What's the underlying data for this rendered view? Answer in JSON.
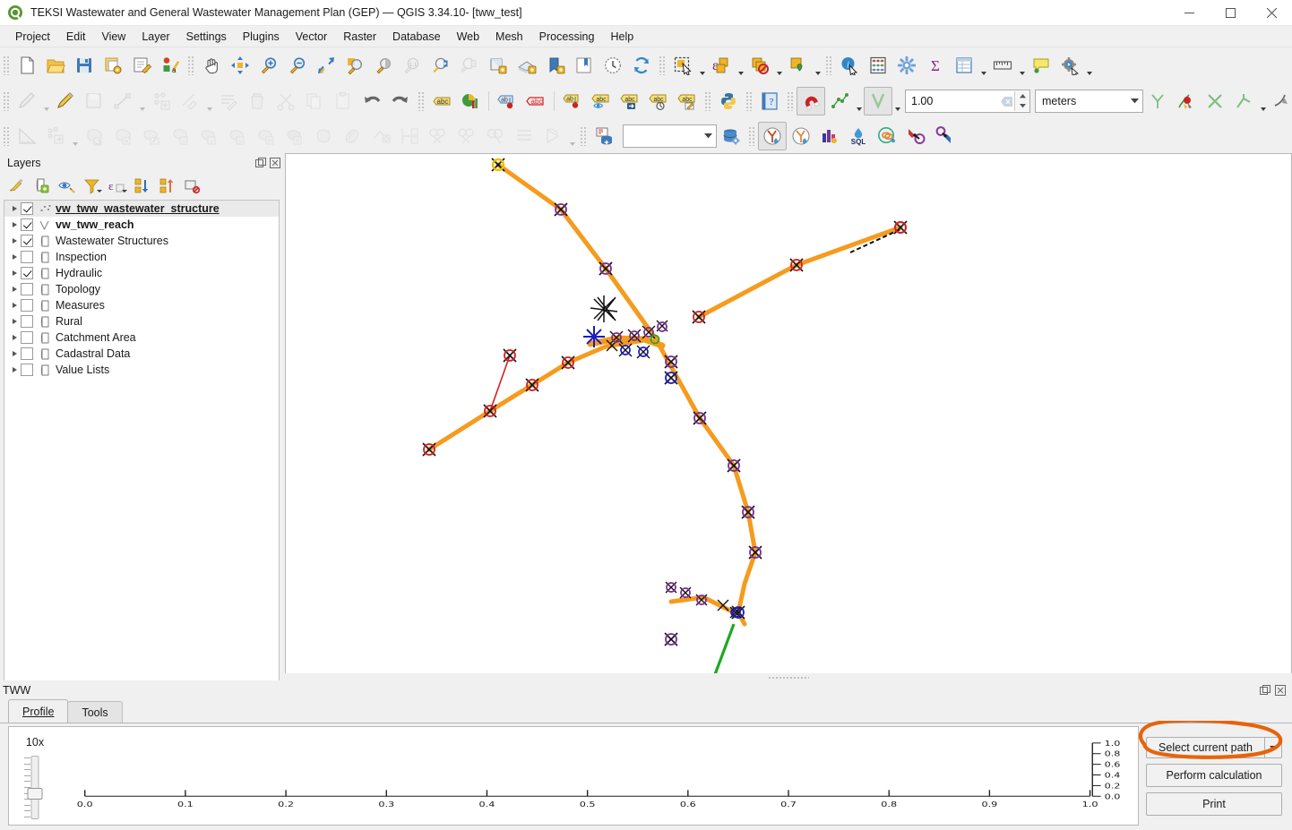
{
  "window": {
    "title": "TEKSI Wastewater and General Wastewater Management Plan (GEP) — QGIS 3.34.10- [tww_test]",
    "app_icon": "qgis-logo-icon",
    "minimize": "—",
    "maximize": "▢",
    "close": "✕"
  },
  "menubar": {
    "items": [
      {
        "label": "Project"
      },
      {
        "label": "Edit"
      },
      {
        "label": "View"
      },
      {
        "label": "Layer"
      },
      {
        "label": "Settings"
      },
      {
        "label": "Plugins"
      },
      {
        "label": "Vector"
      },
      {
        "label": "Raster"
      },
      {
        "label": "Database"
      },
      {
        "label": "Web"
      },
      {
        "label": "Mesh"
      },
      {
        "label": "Processing"
      },
      {
        "label": "Help"
      }
    ]
  },
  "toolbar_row1": [
    {
      "name": "new-project-icon"
    },
    {
      "name": "open-project-icon"
    },
    {
      "name": "save-project-icon"
    },
    {
      "name": "save-project-as-icon"
    },
    {
      "name": "new-print-layout-icon"
    },
    {
      "name": "style-manager-icon"
    },
    {
      "name": "pan-map-icon"
    },
    {
      "name": "pan-to-selection-icon"
    },
    {
      "name": "zoom-in-icon"
    },
    {
      "name": "zoom-out-icon"
    },
    {
      "name": "zoom-full-icon"
    },
    {
      "name": "zoom-to-selection-icon"
    },
    {
      "name": "zoom-to-layer-icon"
    },
    {
      "name": "zoom-native-icon"
    },
    {
      "name": "zoom-last-icon"
    },
    {
      "name": "zoom-next-icon"
    },
    {
      "name": "new-map-view-icon"
    },
    {
      "name": "new-3d-map-view-icon"
    },
    {
      "name": "show-bookmarks-icon"
    },
    {
      "name": "new-bookmark-icon"
    },
    {
      "name": "temporal-controller-icon"
    },
    {
      "name": "refresh-icon"
    },
    {
      "name": "select-features-icon"
    },
    {
      "name": "select-by-expression-icon"
    },
    {
      "name": "deselect-features-icon"
    },
    {
      "name": "identify-highlight-icon"
    },
    {
      "name": "identify-features-icon"
    },
    {
      "name": "field-calculator-icon"
    },
    {
      "name": "options-icon"
    },
    {
      "name": "statistical-summary-icon"
    },
    {
      "name": "open-attribute-table-icon"
    },
    {
      "name": "measure-line-icon"
    },
    {
      "name": "map-tips-icon"
    },
    {
      "name": "processing-toolbox-icon"
    }
  ],
  "toolbar_row2": [
    {
      "name": "current-edits-icon"
    },
    {
      "name": "toggle-editing-icon"
    },
    {
      "name": "save-layer-edits-icon"
    },
    {
      "name": "add-line-feature-icon"
    },
    {
      "name": "add-point-feature-icon"
    },
    {
      "name": "vertex-tool-icon"
    },
    {
      "name": "modify-attributes-icon"
    },
    {
      "name": "delete-selected-icon"
    },
    {
      "name": "cut-features-icon"
    },
    {
      "name": "copy-features-icon"
    },
    {
      "name": "paste-features-icon"
    },
    {
      "name": "undo-icon"
    },
    {
      "name": "redo-icon"
    },
    {
      "name": "label-toolbar-icon"
    },
    {
      "name": "diagram-toolbar-icon"
    },
    {
      "name": "pin-labels-icon"
    },
    {
      "name": "highlight-labels-icon"
    },
    {
      "name": "move-label-icon"
    },
    {
      "name": "show-hide-labels-icon"
    },
    {
      "name": "rotate-label-icon"
    },
    {
      "name": "change-label-icon"
    },
    {
      "name": "python-console-icon"
    },
    {
      "name": "help-icon"
    },
    {
      "name": "snapping-magnet-icon"
    },
    {
      "name": "snapping-mode-icon"
    },
    {
      "name": "snapping-type-icon"
    },
    {
      "name": "topological-editing-icon"
    },
    {
      "name": "avoid-overlap-icon"
    },
    {
      "name": "snap-intersection-icon"
    },
    {
      "name": "tracing-icon"
    },
    {
      "name": "enable-tracing-icon"
    }
  ],
  "snapping": {
    "tolerance_value": "1.00",
    "tolerance_clear_icon": "clear-icon",
    "units_value": "meters",
    "units_caret": "chevron-down-icon"
  },
  "toolbar_row3": [
    {
      "name": "measure-angle-icon"
    },
    {
      "name": "add-circular-string-icon"
    },
    {
      "name": "rotate-feature-icon"
    },
    {
      "name": "simplify-feature-icon"
    },
    {
      "name": "add-ring-icon"
    },
    {
      "name": "add-part-icon"
    },
    {
      "name": "fill-ring-icon"
    },
    {
      "name": "add-part-2-icon"
    },
    {
      "name": "delete-ring-icon"
    },
    {
      "name": "delete-part-icon"
    },
    {
      "name": "reshape-features-icon"
    },
    {
      "name": "offset-curve-icon"
    },
    {
      "name": "reverse-line-icon"
    },
    {
      "name": "trim-extend-icon"
    },
    {
      "name": "split-features-icon"
    },
    {
      "name": "split-parts-icon"
    },
    {
      "name": "merge-features-icon"
    },
    {
      "name": "merge-attributes-icon"
    },
    {
      "name": "rotate-point-symbols-icon"
    },
    {
      "name": "db-manager-icon"
    },
    {
      "name": "database-settings-icon"
    },
    {
      "name": "tww-wizard-icon"
    },
    {
      "name": "tww-profile-icon"
    },
    {
      "name": "tww-network-icon"
    },
    {
      "name": "tww-sql-icon"
    },
    {
      "name": "tww-connect-icon"
    },
    {
      "name": "tww-interlis-export-icon"
    },
    {
      "name": "tww-interlis-import-icon"
    }
  ],
  "layers_panel": {
    "title": "Layers",
    "float_icon": "undock-icon",
    "close_icon": "close-icon",
    "toolbar": [
      {
        "name": "open-layer-styling-icon"
      },
      {
        "name": "add-group-icon"
      },
      {
        "name": "manage-map-themes-icon"
      },
      {
        "name": "filter-legend-icon"
      },
      {
        "name": "filter-legend-expression-icon"
      },
      {
        "name": "expand-all-icon"
      },
      {
        "name": "collapse-all-icon"
      },
      {
        "name": "remove-layer-icon"
      }
    ],
    "items": [
      {
        "label": "vw_tww_wastewater_structure",
        "checked": true,
        "style": "selected",
        "icon": "point-layer-icon"
      },
      {
        "label": "vw_tww_reach",
        "checked": true,
        "style": "bold",
        "icon": "line-layer-icon"
      },
      {
        "label": "Wastewater Structures",
        "checked": true,
        "style": "normal",
        "icon": "group-icon"
      },
      {
        "label": "Inspection",
        "checked": false,
        "style": "normal",
        "icon": "group-icon"
      },
      {
        "label": "Hydraulic",
        "checked": true,
        "style": "normal",
        "icon": "group-icon"
      },
      {
        "label": "Topology",
        "checked": false,
        "style": "normal",
        "icon": "group-icon"
      },
      {
        "label": "Measures",
        "checked": false,
        "style": "normal",
        "icon": "group-icon"
      },
      {
        "label": "Rural",
        "checked": false,
        "style": "normal",
        "icon": "group-icon"
      },
      {
        "label": "Catchment Area",
        "checked": false,
        "style": "normal",
        "icon": "group-icon"
      },
      {
        "label": "Cadastral Data",
        "checked": false,
        "style": "normal",
        "icon": "group-icon"
      },
      {
        "label": "Value Lists",
        "checked": false,
        "style": "normal",
        "icon": "group-icon"
      }
    ]
  },
  "map": {
    "network_color": "#F59B1E",
    "node_colors": [
      "#CC2222",
      "#7B2D96",
      "#1B1BBE",
      "#111111",
      "#FFD700"
    ],
    "highlight_color": "#FF8C00"
  },
  "tww_dock": {
    "title": "TWW",
    "float_icon": "undock-icon",
    "close_icon": "close-icon",
    "tabs": [
      {
        "label": "Profile",
        "active": true
      },
      {
        "label": "Tools",
        "active": false
      }
    ],
    "zoom": {
      "label": "10x",
      "slider_name": "vertical-exaggeration-slider"
    },
    "buttons": [
      {
        "label": "Select current path",
        "name": "select-current-path-button",
        "has_dropdown": true,
        "annotated": true
      },
      {
        "label": "Perform calculation",
        "name": "perform-calculation-button",
        "has_dropdown": false
      },
      {
        "label": "Print",
        "name": "print-button",
        "has_dropdown": false
      }
    ],
    "annotation": {
      "shape": "hand-drawn-ellipse",
      "color": "#E8630A"
    }
  },
  "chart_data": {
    "type": "line",
    "title": "",
    "xlabel": "",
    "ylabel": "",
    "xlim": [
      0.0,
      1.0
    ],
    "ylim": [
      0.0,
      1.0
    ],
    "xticks": [
      "0.0",
      "0.1",
      "0.2",
      "0.3",
      "0.4",
      "0.5",
      "0.6",
      "0.7",
      "0.8",
      "0.9",
      "1.0"
    ],
    "yticks": [
      "0.0",
      "0.2",
      "0.4",
      "0.6",
      "0.8",
      "1.0"
    ],
    "grid": false,
    "legend": "none",
    "series": [],
    "note": "empty profile plot — no data series drawn"
  }
}
